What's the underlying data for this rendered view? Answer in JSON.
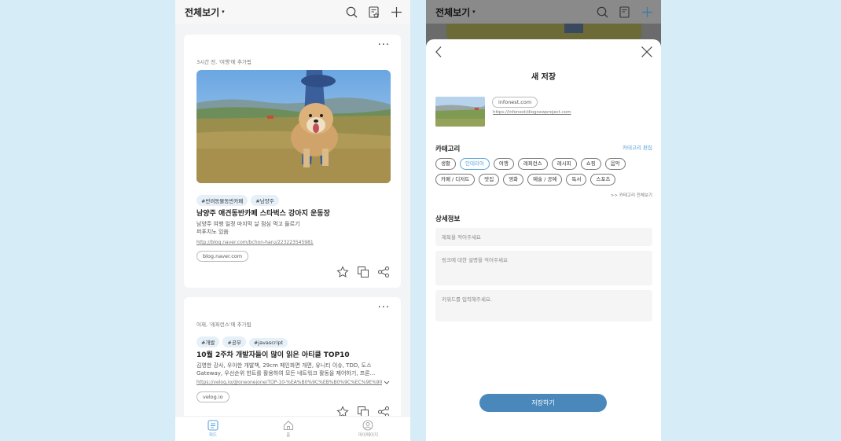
{
  "left": {
    "header": {
      "title": "전체보기",
      "caret": "▾"
    },
    "cards": [
      {
        "meta": "3시간 전, '여행'에 추가됨",
        "more": "···",
        "tags": [
          "#반려동물동반카페",
          "#남양주"
        ],
        "title": "남양주 애견동반카페 스타벅스 강아지 운동장",
        "desc_line1": "남양주 여행 일정 마지막 날 점심 먹고 들르기",
        "desc_line2": "퍼푸치노 있음",
        "link": "http://blog.naver.com/bchon-haru/223223545981",
        "domain": "blog.naver.com"
      },
      {
        "meta": "어제, '레퍼런스'에 추가됨",
        "more": "···",
        "tags": [
          "#개발",
          "#공부",
          "#javascript"
        ],
        "title": "10월 2주차 개발자들이 많이 읽은 아티클 TOP10",
        "desc_line1": "김영한 강사, 우아한 개발책, 29cm 페인화면 개편, 유니티 이슈, TDD, 도스",
        "desc_line2": "Gateway, 우선순위 힌트를 활용하여 모든 네트워크 활동을 제어하기, 프론...",
        "link": "https://velog.io/@oneonejone/TOP-10-%EA%B0%9C%EB%B0%9C%EC%9E%90",
        "domain": "velog.io"
      }
    ],
    "tabbar": [
      {
        "label": "피드",
        "icon": "feed-icon",
        "active": true
      },
      {
        "label": "홈",
        "icon": "home-icon",
        "active": false
      },
      {
        "label": "마이페이지",
        "icon": "profile-icon",
        "active": false
      }
    ]
  },
  "right": {
    "header": {
      "title": "전체보기",
      "caret": "▾"
    },
    "sheet": {
      "title": "새 저장",
      "domain": "infonest.com",
      "url": "https://infonest/diognewproject.com",
      "category_label": "카테고리",
      "edit_category": "카테고리 편집",
      "categories": [
        "생활",
        "인테리어",
        "여행",
        "레퍼런스",
        "레시피",
        "쇼핑",
        "음악",
        "카페 / 디저트",
        "맛집",
        "영화",
        "예술 / 공예",
        "독서",
        "스포츠"
      ],
      "selected_category": "인테리어",
      "view_all": ">> 카테고리 전체보기",
      "details_label": "상세정보",
      "title_placeholder": "제목을 적어주세요",
      "desc_placeholder": "링크에 대한 설명을 적어주세요",
      "keyword_placeholder": "키워드를 입력해주세요.",
      "save_label": "저장하기"
    }
  },
  "colors": {
    "accent": "#5aa3d8",
    "button": "#4a88bc",
    "background": "#d6ecf6"
  }
}
